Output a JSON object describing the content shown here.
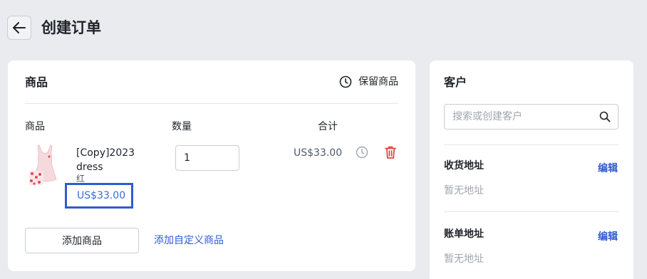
{
  "header": {
    "title": "创建订单",
    "back_icon": "arrow-left-icon"
  },
  "products_card": {
    "title": "商品",
    "hold_label": "保留商品",
    "columns": {
      "product": "商品",
      "quantity": "数量",
      "total": "合计"
    },
    "items": [
      {
        "name": "[Copy]2023 dress",
        "variant": "红",
        "price": "US$33.00",
        "quantity": "1",
        "total": "US$33.00"
      }
    ],
    "add_button": "添加商品",
    "custom_link": "添加自定义商品"
  },
  "customer_card": {
    "title": "客户",
    "search_placeholder": "搜索或创建客户",
    "shipping": {
      "title": "收货地址",
      "edit": "编辑",
      "empty": "暂无地址"
    },
    "billing": {
      "title": "账单地址",
      "edit": "编辑",
      "empty": "暂无地址"
    }
  },
  "colors": {
    "accent": "#2f5ccf",
    "danger": "#e0453a",
    "background": "#e9ebef"
  }
}
